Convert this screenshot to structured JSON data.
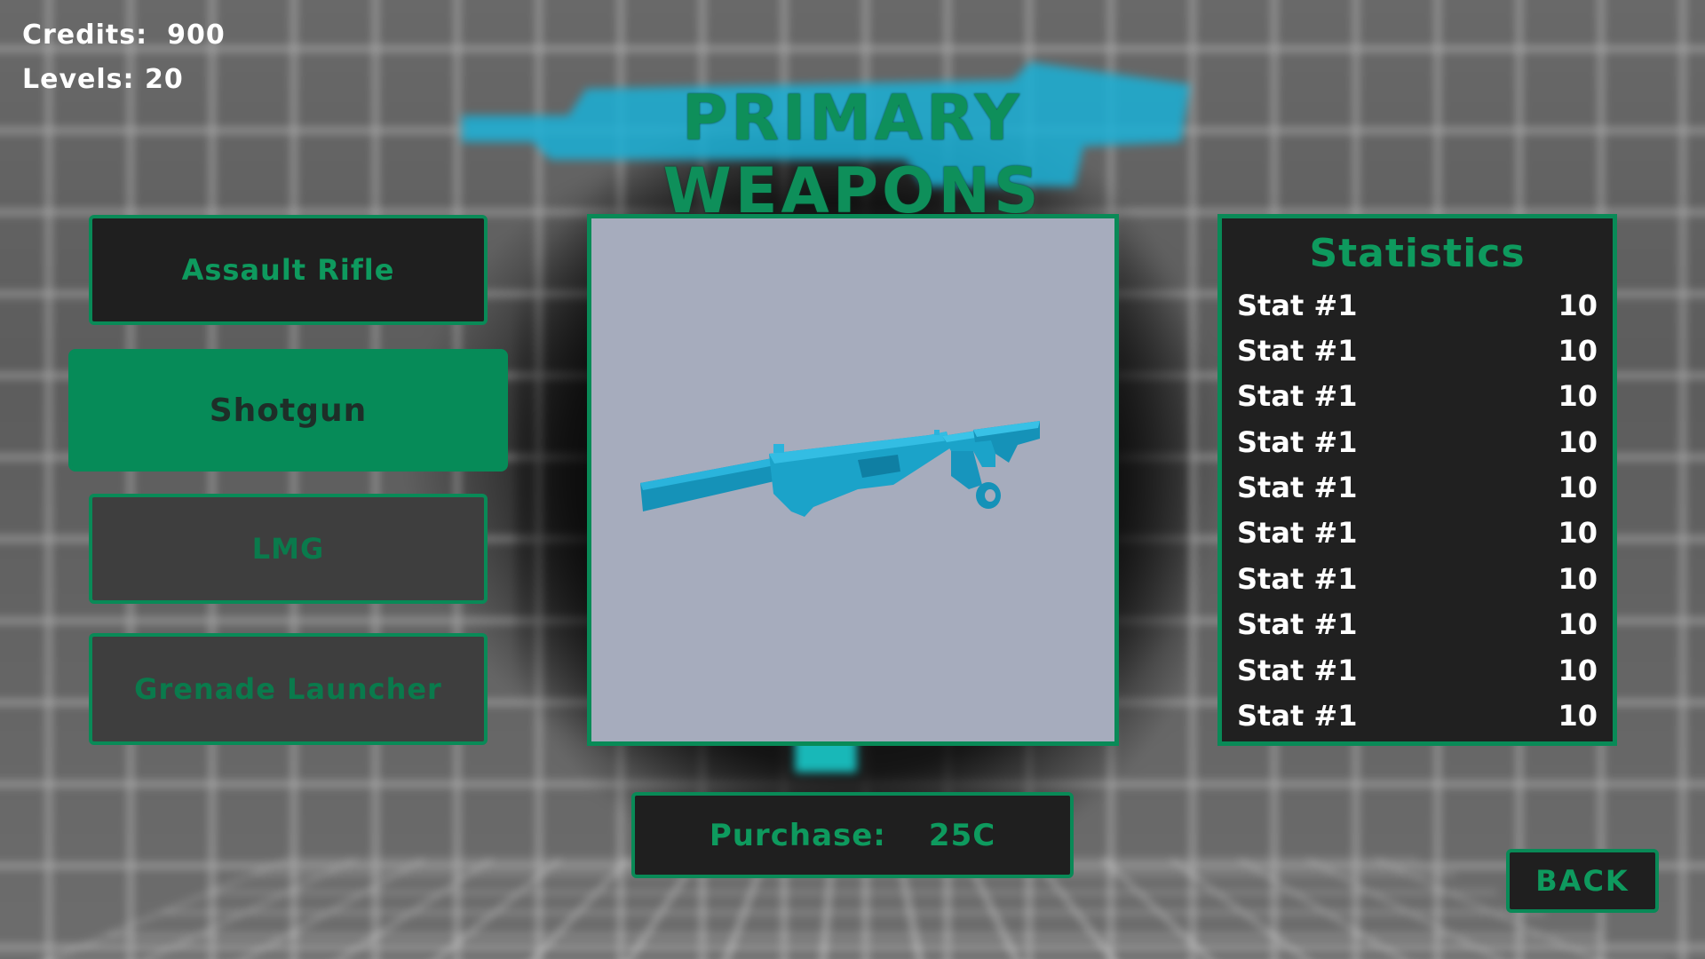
{
  "hud": {
    "credits_label": "Credits:",
    "credits_value": "900",
    "levels_label": "Levels:",
    "levels_value": "20"
  },
  "title": "PRIMARY WEAPONS",
  "categories": [
    {
      "label": "Assault Rifle",
      "state": "normal"
    },
    {
      "label": "Shotgun",
      "state": "selected"
    },
    {
      "label": "LMG",
      "state": "disabled"
    },
    {
      "label": "Grenade Launcher",
      "state": "disabled"
    }
  ],
  "preview": {
    "weapon_icon": "shotgun-model",
    "weapon_color": "#1aa3c7",
    "background_color": "#a6acbd"
  },
  "statistics": {
    "title": "Statistics",
    "rows": [
      {
        "name": "Stat #1",
        "value": "10"
      },
      {
        "name": "Stat #1",
        "value": "10"
      },
      {
        "name": "Stat #1",
        "value": "10"
      },
      {
        "name": "Stat #1",
        "value": "10"
      },
      {
        "name": "Stat #1",
        "value": "10"
      },
      {
        "name": "Stat #1",
        "value": "10"
      },
      {
        "name": "Stat #1",
        "value": "10"
      },
      {
        "name": "Stat #1",
        "value": "10"
      },
      {
        "name": "Stat #1",
        "value": "10"
      },
      {
        "name": "Stat #1",
        "value": "10"
      }
    ]
  },
  "purchase": {
    "label": "Purchase:",
    "price": "25C"
  },
  "back_label": "BACK",
  "colors": {
    "accent": "#098a57",
    "accent_text": "#0e9a5e",
    "panel": "#1f1f1f",
    "disabled_panel": "#3e3e3e"
  }
}
